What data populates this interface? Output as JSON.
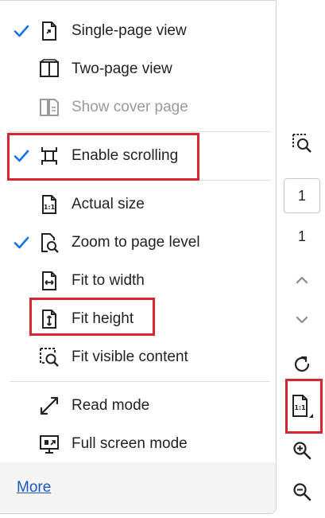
{
  "menu": {
    "items": [
      {
        "label": "Single-page view",
        "checked": true,
        "disabled": false,
        "icon": "single-page-icon"
      },
      {
        "label": "Two-page view",
        "checked": false,
        "disabled": false,
        "icon": "two-page-icon"
      },
      {
        "label": "Show cover page",
        "checked": false,
        "disabled": true,
        "icon": "cover-page-icon"
      },
      {
        "label": "Enable scrolling",
        "checked": true,
        "disabled": false,
        "icon": "scrolling-icon"
      },
      {
        "label": "Actual size",
        "checked": false,
        "disabled": false,
        "icon": "actual-size-icon"
      },
      {
        "label": "Zoom to page level",
        "checked": true,
        "disabled": false,
        "icon": "zoom-page-icon"
      },
      {
        "label": "Fit to width",
        "checked": false,
        "disabled": false,
        "icon": "fit-width-icon"
      },
      {
        "label": "Fit height",
        "checked": false,
        "disabled": false,
        "icon": "fit-height-icon"
      },
      {
        "label": "Fit visible content",
        "checked": false,
        "disabled": false,
        "icon": "fit-visible-icon"
      },
      {
        "label": "Read mode",
        "checked": false,
        "disabled": false,
        "icon": "read-mode-icon"
      },
      {
        "label": "Full screen mode",
        "checked": false,
        "disabled": false,
        "icon": "full-screen-icon"
      }
    ],
    "more_label": "More"
  },
  "toolbar": {
    "page_input": "1",
    "page_total": "1",
    "icons": [
      "marquee-zoom-icon",
      "page-up-icon",
      "page-down-icon",
      "rotate-icon",
      "page-display-icon",
      "zoom-in-icon",
      "zoom-out-icon"
    ]
  },
  "colors": {
    "accent": "#1473e6",
    "highlight": "#d7262f",
    "link": "#1a56c4",
    "disabled_text": "#9a9a9a"
  }
}
